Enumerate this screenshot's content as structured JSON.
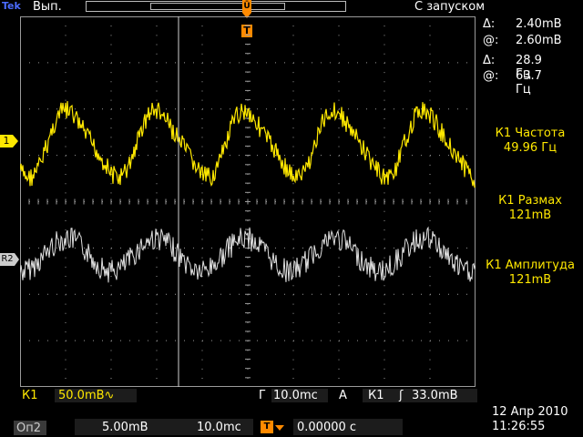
{
  "header": {
    "brand_main": "Tek",
    "run_state": "Вып.",
    "trigger_status": "С запуском",
    "trigger_pos_glyph": "Ū",
    "trigger_marker_glyph": "T"
  },
  "channel_markers": {
    "ch1": "1",
    "ref2": "R2"
  },
  "cursors": {
    "amplitude_delta_symbol": "Δ:",
    "amplitude_delta": "2.40mB",
    "amplitude_at_symbol": "@:",
    "amplitude_at": "2.60mB",
    "freq_delta_symbol": "Δ:",
    "freq_delta": "28.9 Гц",
    "freq_at_symbol": "@:",
    "freq_at": "63.7 Гц"
  },
  "measurements": [
    {
      "label": "К1 Частота",
      "value": "49.96 Гц"
    },
    {
      "label": "К1 Размах",
      "value": "121mB"
    },
    {
      "label": "К1 Амплитуда",
      "value": "121mB"
    }
  ],
  "status_bar": {
    "ch1_label": "К1",
    "ch1_scale": "50.0mB∿",
    "time_label": "Г",
    "time_scale": "10.0mc",
    "trig_label": "А",
    "trig_source": "К1",
    "trig_slope": "ʃ",
    "trig_level": "33.0mB",
    "op2_label": "Оп2",
    "ref_vscale": "5.00mB",
    "ref_tscale": "10.0mc",
    "hpos_icon": "T",
    "hpos_value": "0.00000 с",
    "date": "12 Апр 2010",
    "time": "11:26:55"
  },
  "colors": {
    "ch1": "#ffe800",
    "ref2": "#e0e0e0",
    "trigger": "#ff8a00",
    "grid": "#9a9a9a"
  }
}
